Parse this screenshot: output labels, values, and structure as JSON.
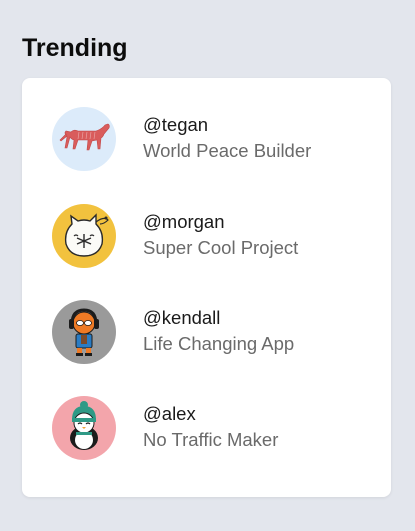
{
  "trending": {
    "title": "Trending",
    "items": [
      {
        "handle": "@tegan",
        "project": "World Peace Builder",
        "avatar_icon": "dog-icon",
        "avatar_bg": "#dcebfa"
      },
      {
        "handle": "@morgan",
        "project": "Super Cool Project",
        "avatar_icon": "cat-icon",
        "avatar_bg": "#f2c23e"
      },
      {
        "handle": "@kendall",
        "project": "Life Changing App",
        "avatar_icon": "robot-headphones-icon",
        "avatar_bg": "#9a9a9a"
      },
      {
        "handle": "@alex",
        "project": "No Traffic Maker",
        "avatar_icon": "penguin-icon",
        "avatar_bg": "#f3a5ab"
      }
    ]
  }
}
